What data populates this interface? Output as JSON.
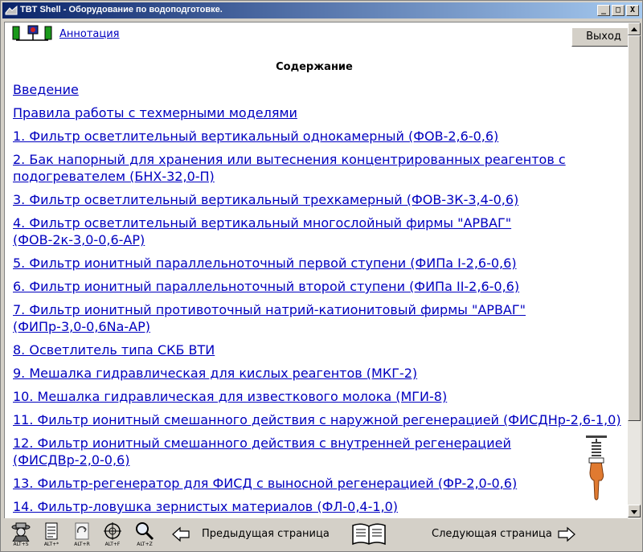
{
  "window": {
    "title": "TBT Shell - Оборудование по водоподготовке.",
    "controls": {
      "minimize": "_",
      "maximize": "□",
      "close": "X"
    }
  },
  "header": {
    "annotation_link": "Аннотация",
    "exit_button": "Выход"
  },
  "main": {
    "heading": "Содержание",
    "toc": [
      {
        "lines": [
          "Введение"
        ]
      },
      {
        "lines": [
          "Правила работы с техмерными моделями"
        ]
      },
      {
        "lines": [
          "1. Фильтр осветлительный вертикальный однокамерный (ФОВ-2,6-0,6)"
        ]
      },
      {
        "lines": [
          "2. Бак напорный для хранения или вытеснения концентрированных реагентов с",
          "подогревателем (БНХ-32,0-П)"
        ]
      },
      {
        "lines": [
          "3. Фильтр осветлительный вертикальный трехкамерный (ФОВ-3К-3,4-0,6)"
        ]
      },
      {
        "lines": [
          "4. Фильтр осветлительный вертикальный многослойный фирмы \"АРВАГ\"",
          "(ФОВ-2к-3,0-0,6-АР)"
        ]
      },
      {
        "lines": [
          "5. Фильтр ионитный параллельноточный первой ступени (ФИПа I-2,6-0,6)"
        ]
      },
      {
        "lines": [
          "6. Фильтр ионитный параллельноточный второй ступени (ФИПа II-2,6-0,6)"
        ]
      },
      {
        "lines": [
          "7. Фильтр ионитный противоточный натрий-катионитовый фирмы \"АРВАГ\"",
          "(ФИПр-3,0-0,6Na-АР)"
        ]
      },
      {
        "lines": [
          "8. Осветлитель типа СКБ ВТИ"
        ]
      },
      {
        "lines": [
          "9. Мешалка гидравлическая для кислых реагентов (МКГ-2)"
        ]
      },
      {
        "lines": [
          "10. Мешалка гидравлическая для известкового молока (МГИ-8)"
        ]
      },
      {
        "lines": [
          "11. Фильтр ионитный смешанного действия с наружной регенерацией (ФИСДНр-2,6-1,0)"
        ]
      },
      {
        "lines": [
          "12. Фильтр ионитный смешанного действия с внутренней регенерацией",
          "(ФИСДВр-2,0-0,6)"
        ]
      },
      {
        "lines": [
          "13. Фильтр-регенератор для ФИСД с выносной регенерацией (ФР-2,0-0,6)"
        ]
      },
      {
        "lines": [
          "14. Фильтр-ловушка зернистых материалов (ФЛ-0,4-1,0)"
        ]
      }
    ]
  },
  "bottom_toolbar": {
    "tools": [
      {
        "icon": "detective-icon",
        "hotkey": "ALT+S"
      },
      {
        "icon": "document-icon",
        "hotkey": "ALT+*"
      },
      {
        "icon": "refresh-page-icon",
        "hotkey": "ALT+R"
      },
      {
        "icon": "target-icon",
        "hotkey": "ALT+F"
      },
      {
        "icon": "magnifier-icon",
        "hotkey": "ALT+Z"
      }
    ],
    "prev_label": "Предыдущая страница",
    "next_label": "Следующая страница"
  },
  "colors": {
    "link": "#0000c0",
    "title_bar_start": "#0a246a",
    "title_bar_end": "#a6caf0",
    "chrome": "#d4d0c8"
  }
}
